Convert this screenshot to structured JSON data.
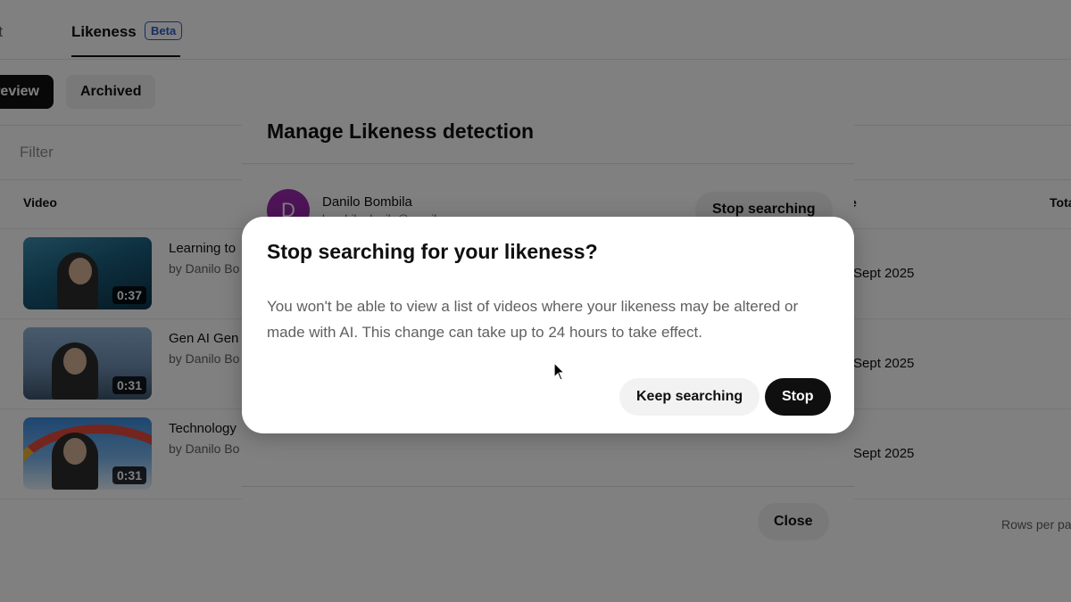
{
  "tabs": [
    {
      "label": "right"
    },
    {
      "label": "Likeness",
      "badge": "Beta",
      "active": true
    }
  ],
  "chips": [
    {
      "label": "review",
      "selected": true
    },
    {
      "label": "Archived"
    }
  ],
  "filter": {
    "placeholder": "Filter"
  },
  "table": {
    "columns": [
      "Video",
      "e",
      "Tota"
    ],
    "rows": [
      {
        "title": "Learning to",
        "by": "by Danilo Bo",
        "duration": "0:37",
        "date": "Sept 2025",
        "icon": "video-thumbnail-diver"
      },
      {
        "title": "Gen AI Gen",
        "by": "by Danilo Bo",
        "duration": "0:31",
        "date": "Sept 2025",
        "icon": "video-thumbnail-person"
      },
      {
        "title": "Technology",
        "by": "by Danilo Bo",
        "duration": "0:31",
        "date": "Sept 2025",
        "icon": "video-thumbnail-rainbow"
      }
    ],
    "footer": {
      "rows_per_page": "Rows per pa"
    }
  },
  "manage_dialog": {
    "title": "Manage Likeness detection",
    "profile": {
      "initial": "D",
      "name": "Danilo Bombila",
      "email": "bombila.danilo@gmail.com",
      "avatar_color": "#9c27b0"
    },
    "stop_button": "Stop searching",
    "close_button": "Close"
  },
  "confirm_dialog": {
    "title": "Stop searching for your likeness?",
    "body": "You won't be able to view a list of videos where your likeness may be altered or made with AI. This change can take up to 24 hours to take effect.",
    "keep_button": "Keep searching",
    "stop_button": "Stop"
  },
  "colors": {
    "accent": "#0f0f0f",
    "beta": "#2d5cc9",
    "scrim_dim": "0.5"
  }
}
